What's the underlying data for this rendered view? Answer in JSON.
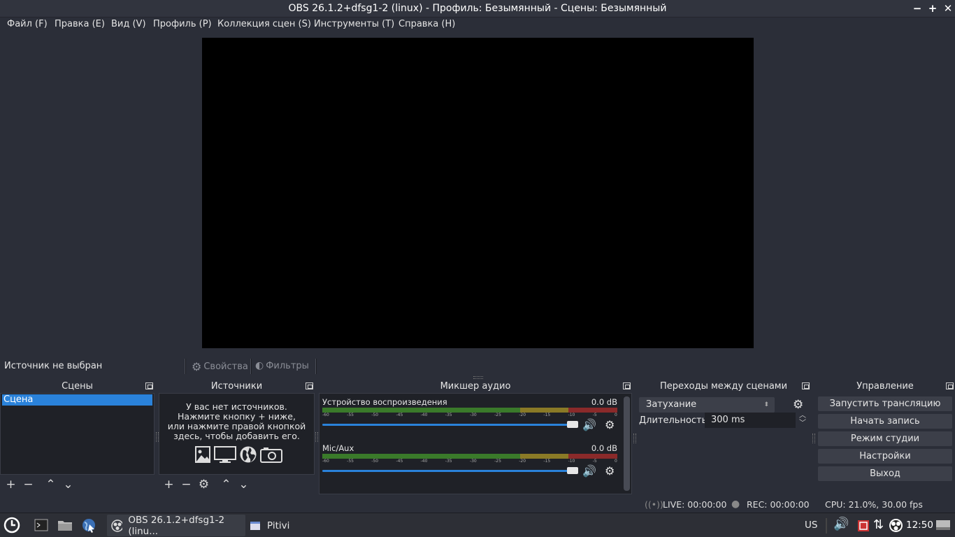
{
  "window": {
    "title": "OBS 26.1.2+dfsg1-2 (linux) - Профиль: Безымянный - Сцены: Безымянный",
    "minimize": "−",
    "maximize": "+",
    "close": "✕"
  },
  "menu": {
    "file": "Файл (F)",
    "edit": "Правка (E)",
    "view": "Вид (V)",
    "profile": "Профиль (P)",
    "scene_collection": "Коллекция сцен (S)",
    "tools": "Инструменты (T)",
    "help": "Справка (H)"
  },
  "source_toolbar": {
    "no_source": "Источник не выбран",
    "properties": "Свойства",
    "filters": "Фильтры"
  },
  "scenes": {
    "title": "Сцены",
    "items": [
      "Сцена"
    ]
  },
  "sources": {
    "title": "Источники",
    "empty_line1": "У вас нет источников.",
    "empty_line2": "Нажмите кнопку + ниже,",
    "empty_line3": "или нажмите правой кнопкой",
    "empty_line4": "здесь, чтобы добавить его."
  },
  "mixer": {
    "title": "Микшер аудио",
    "ticks": [
      "-60",
      "-55",
      "-50",
      "-45",
      "-40",
      "-35",
      "-30",
      "-25",
      "-20",
      "-15",
      "-10",
      "-5",
      "0"
    ],
    "channels": [
      {
        "name": "Устройство воспроизведения",
        "db": "0.0 dB",
        "level": 1.0
      },
      {
        "name": "Mic/Aux",
        "db": "0.0 dB",
        "level": 1.0
      }
    ]
  },
  "transitions": {
    "title": "Переходы между сценами",
    "selected": "Затухание",
    "duration_label": "Длительность",
    "duration_value": "300 ms"
  },
  "controls": {
    "title": "Управление",
    "start_stream": "Запустить трансляцию",
    "start_record": "Начать запись",
    "studio_mode": "Режим студии",
    "settings": "Настройки",
    "exit": "Выход"
  },
  "status": {
    "live": "LIVE: 00:00:00",
    "rec": "REC: 00:00:00",
    "cpu": "CPU: 21.0%, 30.00 fps"
  },
  "taskbar": {
    "tasks": [
      "OBS 26.1.2+dfsg1-2 (linu...",
      "Pitivi"
    ],
    "keyboard": "US",
    "clock": "12:50"
  },
  "colors": {
    "accent": "#2a82da",
    "panel_bg": "#2b2e38",
    "list_bg": "#1f2127"
  }
}
